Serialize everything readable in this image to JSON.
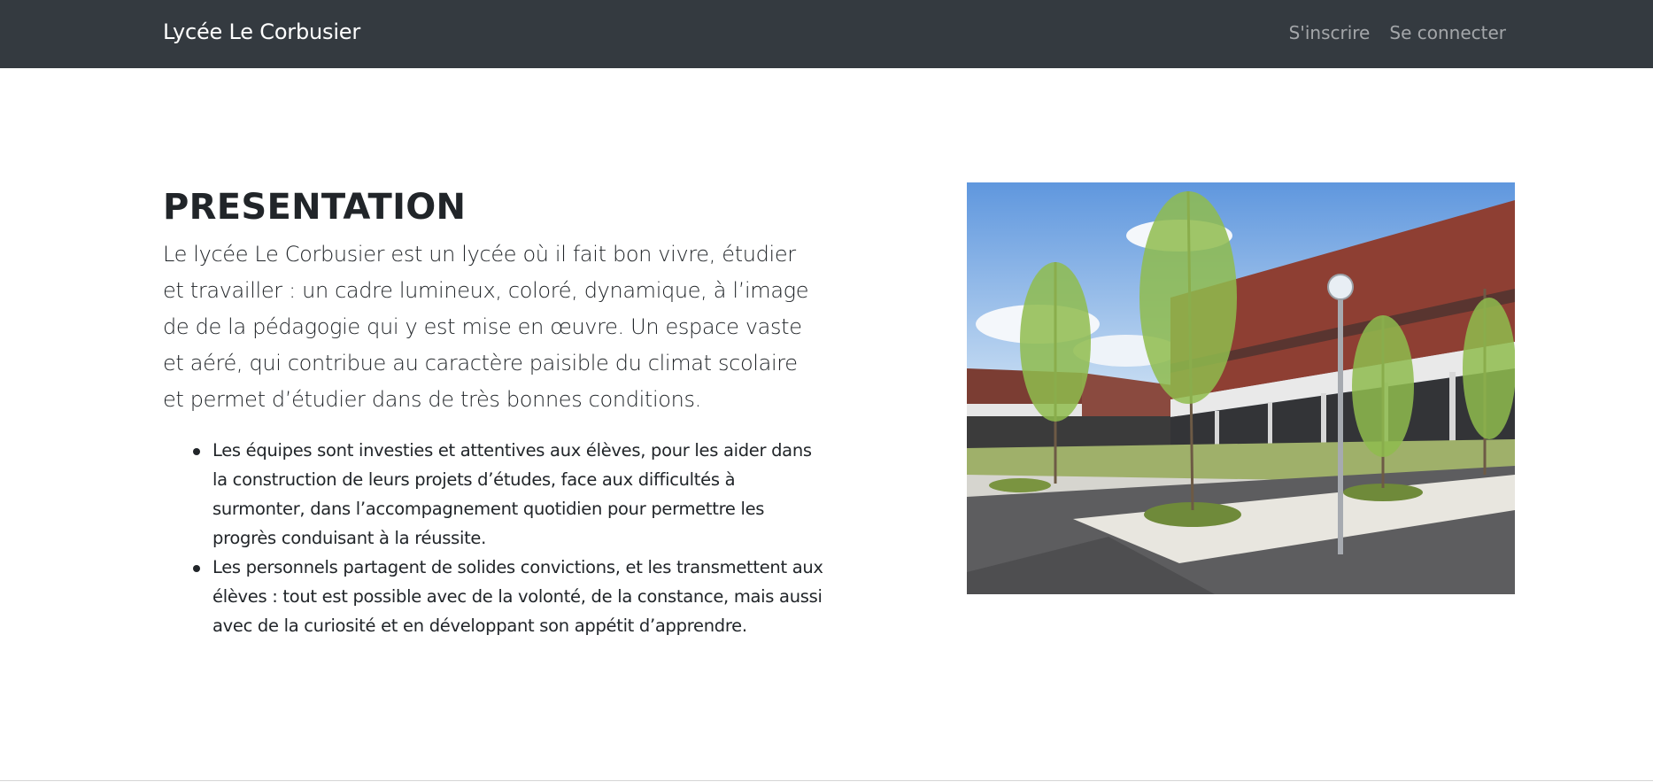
{
  "navbar": {
    "brand": "Lycée Le Corbusier",
    "links": [
      {
        "label": "S'inscrire"
      },
      {
        "label": "Se connecter"
      }
    ]
  },
  "main": {
    "title": "PRESENTATION",
    "lead": "Le lycée Le Corbusier est un lycée où il fait bon vivre, étudier et travailler : un cadre lumineux, coloré, dynamique, à l’image de de la pédagogie qui y est mise en œuvre. Un espace vaste et aéré, qui contribue au caractère paisible du climat scolaire et permet d’étudier dans de très bonnes conditions.",
    "bullets": [
      "Les équipes sont investies et attentives aux élèves, pour les aider dans la construction de leurs projets d’études, face aux difficultés à surmonter, dans l’accompagnement quotidien pour permettre les progrès conduisant à la réussite.",
      "Les personnels partagent de solides convictions, et les transmettent aux élèves : tout est possible avec de la volonté, de la constance, mais aussi avec de la curiosité et en développant son appétit d’apprendre."
    ]
  },
  "colors": {
    "navbar_bg": "#343a40",
    "brand_text": "#ffffff",
    "nav_link_text": "#9a9da0",
    "body_text": "#212529"
  }
}
